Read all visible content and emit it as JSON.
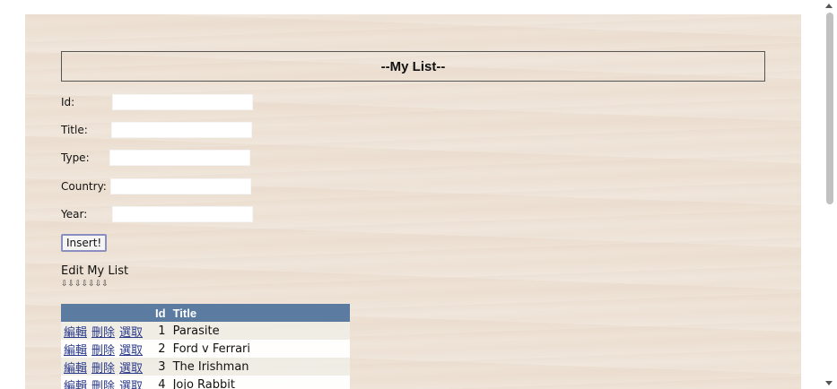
{
  "header": {
    "title": "--My List--"
  },
  "form": {
    "fields": [
      {
        "label": "Id:",
        "value": ""
      },
      {
        "label": "Title:",
        "value": ""
      },
      {
        "label": "Type:",
        "value": ""
      },
      {
        "label": "Country:",
        "value": ""
      },
      {
        "label": "Year:",
        "value": ""
      }
    ],
    "insert_label": "Insert!"
  },
  "edit": {
    "heading": "Edit My List",
    "arrows": "⇩⇩⇩⇩⇩⇩⇩"
  },
  "table": {
    "columns": [
      "",
      "Id",
      "Title"
    ],
    "actions": {
      "edit": "編輯",
      "delete": "刪除",
      "select": "選取"
    },
    "rows": [
      {
        "id": "1",
        "title": "Parasite"
      },
      {
        "id": "2",
        "title": "Ford v Ferrari"
      },
      {
        "id": "3",
        "title": "The Irishman"
      },
      {
        "id": "4",
        "title": "Jojo Rabbit"
      }
    ]
  }
}
